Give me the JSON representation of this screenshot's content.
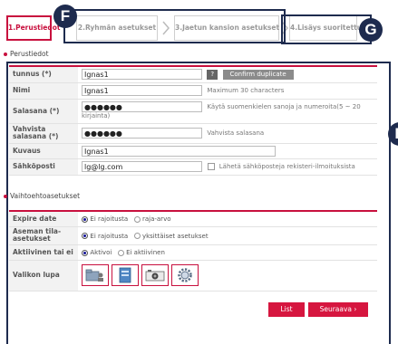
{
  "steps": [
    {
      "label": "1.Perustiedot"
    },
    {
      "label": "2.Ryhmän asetukset"
    },
    {
      "label": "3.Jaetun kansion asetukset"
    },
    {
      "label": "4.Lisäys suoritettu"
    }
  ],
  "markers": {
    "f": "F",
    "g": "G",
    "e": "E"
  },
  "basic": {
    "title": "Perustiedot",
    "rows": {
      "id": {
        "label": "tunnus (*)",
        "value": "Ignas1",
        "help_button": "?",
        "dup_button": "Confirm duplicate"
      },
      "name": {
        "label": "Nimi",
        "value": "Ignas1",
        "hint": "Maximum 30 characters"
      },
      "password": {
        "label": "Salasana (*)",
        "value": "●●●●●●",
        "hint": "Käytä suomenkielen sanoja ja numeroita(5 ~ 20 kirjainta)"
      },
      "confirm": {
        "label": "Vahvista salasana (*)",
        "value": "●●●●●●",
        "hint": "Vahvista salasana"
      },
      "desc": {
        "label": "Kuvaus",
        "value": "Ignas1"
      },
      "email": {
        "label": "Sähköposti",
        "value": "lg@lg.com",
        "checkbox_label": "Lähetä sähköposteja rekisteri-ilmoituksista"
      }
    }
  },
  "optional": {
    "title": "Vaihtoehtoasetukset",
    "rows": {
      "expire": {
        "label": "Expire date",
        "opt1": "Ei rajoitusta",
        "opt2": "raja-arvo"
      },
      "quota": {
        "label": "Aseman tila-asetukset",
        "opt1": "Ei rajoitusta",
        "opt2": "yksittäiset asetukset"
      },
      "active": {
        "label": "Aktiivinen tai ei",
        "opt1": "Aktivoi",
        "opt2": "Ei aktiivinen"
      },
      "perm": {
        "label": "Valikon lupa",
        "icons": [
          "folder-user-icon",
          "file-upload-icon",
          "camera-icon",
          "settings-gear-icon"
        ]
      }
    }
  },
  "buttons": {
    "list": "List",
    "next": "Seuraava ›"
  },
  "colors": {
    "accent": "#c8103e",
    "marker": "#1e2b4e"
  }
}
